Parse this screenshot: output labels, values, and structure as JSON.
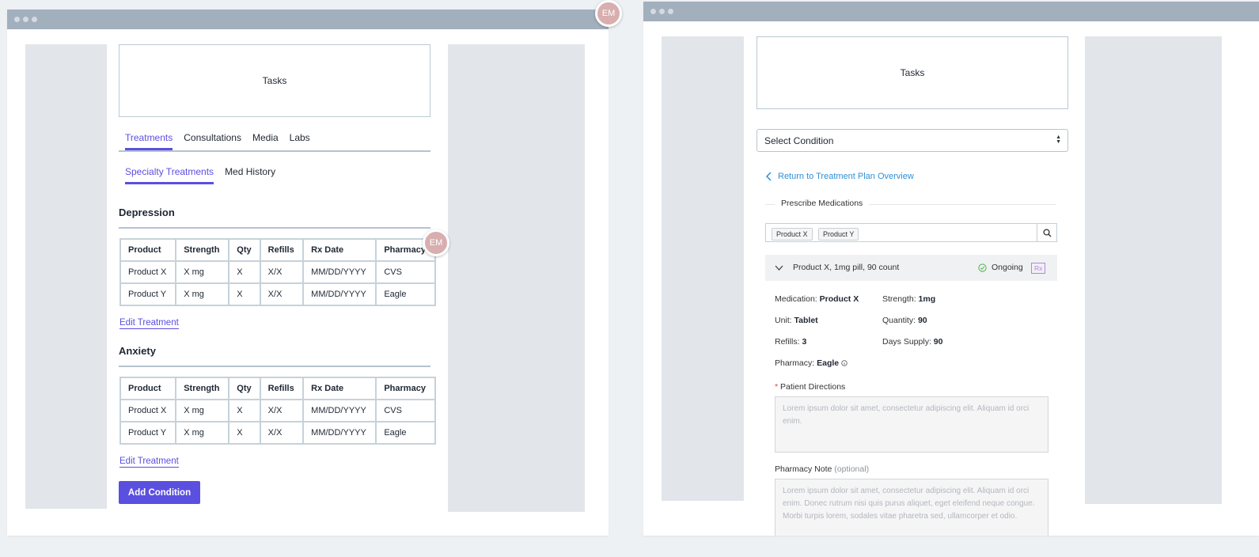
{
  "user": {
    "initials": "EM"
  },
  "left": {
    "tasks": "Tasks",
    "tabs": [
      "Treatments",
      "Consultations",
      "Media",
      "Labs"
    ],
    "subtabs": [
      "Specialty Treatments",
      "Med History"
    ],
    "columns": [
      "Product",
      "Strength",
      "Qty",
      "Refills",
      "Rx Date",
      "Pharmacy"
    ],
    "conditions": [
      {
        "title": "Depression",
        "rows": [
          [
            "Product X",
            "X mg",
            "X",
            "X/X",
            "MM/DD/YYYY",
            "CVS"
          ],
          [
            "Product Y",
            "X mg",
            "X",
            "X/X",
            "MM/DD/YYYY",
            "Eagle"
          ]
        ],
        "edit": "Edit Treatment"
      },
      {
        "title": "Anxiety",
        "rows": [
          [
            "Product X",
            "X mg",
            "X",
            "X/X",
            "MM/DD/YYYY",
            "CVS"
          ],
          [
            "Product Y",
            "X mg",
            "X",
            "X/X",
            "MM/DD/YYYY",
            "Eagle"
          ]
        ],
        "edit": "Edit Treatment"
      }
    ],
    "add_condition": "Add Condition"
  },
  "right": {
    "tasks": "Tasks",
    "select_condition": "Select Condition",
    "back_link": "Return to Treatment Plan Overview",
    "section": "Prescribe Medications",
    "tags": [
      "Product X",
      "Product Y"
    ],
    "med_title": "Product X, 1mg pill, 90 count",
    "med_status": "Ongoing",
    "rx_badge": "Rx",
    "fields": {
      "medication_label": "Medication:",
      "medication": "Product X",
      "strength_label": "Strength:",
      "strength": "1mg",
      "unit_label": "Unit:",
      "unit": "Tablet",
      "quantity_label": "Quantity:",
      "quantity": "90",
      "refills_label": "Refills:",
      "refills": "3",
      "days_label": "Days Supply:",
      "days": "90",
      "pharmacy_label": "Pharmacy:",
      "pharmacy": "Eagle"
    },
    "patient_directions_label": "Patient Directions",
    "patient_directions_placeholder": "Lorem ipsum dolor sit amet, consectetur adipiscing elit. Aliquam id orci enim.",
    "pharmacy_note_label": "Pharmacy Note",
    "pharmacy_note_optional": "(optional)",
    "pharmacy_note_placeholder": "Lorem ipsum dolor sit amet, consectetur adipiscing elit. Aliquam id orci enim. Donec rutrum nisi quis purus aliquet, eget eleifend neque congue. Morbi turpis lorem, sodales vitae pharetra sed, ullamcorper et odio."
  },
  "colors": {
    "accent": "#5b4fe0",
    "link": "#2f8fd6",
    "titlebar": "#a2afbd",
    "panel": "#e2e6ea",
    "ongoing": "#5cb85c",
    "rx": "#b583e0"
  }
}
